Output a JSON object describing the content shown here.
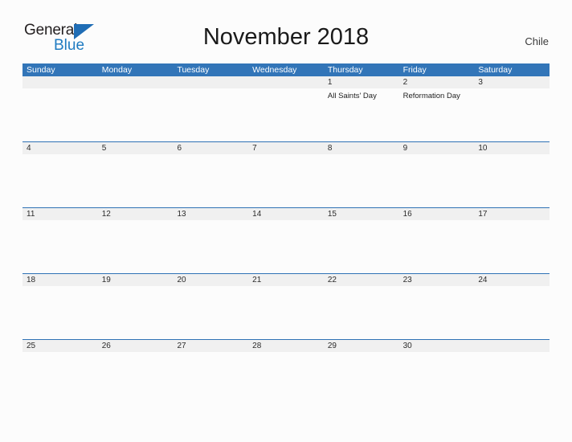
{
  "brand": {
    "name_part1": "General",
    "name_part2": "Blue",
    "flag_icon": "flag-triangle-icon",
    "color_dark": "#231f20",
    "color_blue": "#1f7bc1"
  },
  "header": {
    "title": "November 2018",
    "region": "Chile"
  },
  "theme": {
    "header_blue": "#3275b8",
    "separator_blue": "#2f72b5",
    "date_band_gray": "#f0f0f0",
    "page_background": "#fcfcfc"
  },
  "calendar": {
    "weekdays": [
      "Sunday",
      "Monday",
      "Tuesday",
      "Wednesday",
      "Thursday",
      "Friday",
      "Saturday"
    ],
    "weeks": [
      {
        "days": [
          {
            "date": "",
            "events": ""
          },
          {
            "date": "",
            "events": ""
          },
          {
            "date": "",
            "events": ""
          },
          {
            "date": "",
            "events": ""
          },
          {
            "date": "1",
            "events": "All Saints' Day"
          },
          {
            "date": "2",
            "events": "Reformation Day"
          },
          {
            "date": "3",
            "events": ""
          }
        ]
      },
      {
        "days": [
          {
            "date": "4",
            "events": ""
          },
          {
            "date": "5",
            "events": ""
          },
          {
            "date": "6",
            "events": ""
          },
          {
            "date": "7",
            "events": ""
          },
          {
            "date": "8",
            "events": ""
          },
          {
            "date": "9",
            "events": ""
          },
          {
            "date": "10",
            "events": ""
          }
        ]
      },
      {
        "days": [
          {
            "date": "11",
            "events": ""
          },
          {
            "date": "12",
            "events": ""
          },
          {
            "date": "13",
            "events": ""
          },
          {
            "date": "14",
            "events": ""
          },
          {
            "date": "15",
            "events": ""
          },
          {
            "date": "16",
            "events": ""
          },
          {
            "date": "17",
            "events": ""
          }
        ]
      },
      {
        "days": [
          {
            "date": "18",
            "events": ""
          },
          {
            "date": "19",
            "events": ""
          },
          {
            "date": "20",
            "events": ""
          },
          {
            "date": "21",
            "events": ""
          },
          {
            "date": "22",
            "events": ""
          },
          {
            "date": "23",
            "events": ""
          },
          {
            "date": "24",
            "events": ""
          }
        ]
      },
      {
        "days": [
          {
            "date": "25",
            "events": ""
          },
          {
            "date": "26",
            "events": ""
          },
          {
            "date": "27",
            "events": ""
          },
          {
            "date": "28",
            "events": ""
          },
          {
            "date": "29",
            "events": ""
          },
          {
            "date": "30",
            "events": ""
          },
          {
            "date": "",
            "events": ""
          }
        ]
      }
    ]
  }
}
